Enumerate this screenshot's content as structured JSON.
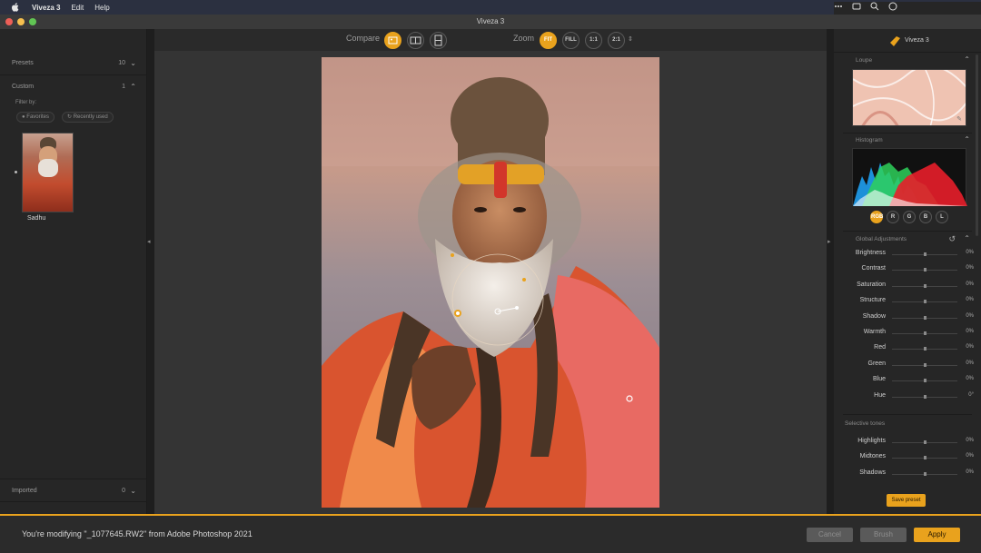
{
  "menubar": {
    "app": "Viveza 3",
    "items": [
      "Edit",
      "Help"
    ]
  },
  "window": {
    "title": "Viveza 3"
  },
  "left_panel": {
    "presets": {
      "label": "Presets",
      "count": "10"
    },
    "custom": {
      "label": "Custom",
      "count": "1"
    },
    "filter_label": "Filter by:",
    "filters": [
      "Favorites",
      "Recently used"
    ],
    "thumb_name": "Sadhu",
    "imported": {
      "label": "Imported",
      "count": "0"
    }
  },
  "toolbar": {
    "compare_label": "Compare",
    "zoom_label": "Zoom",
    "zoom_options": [
      "FIT",
      "FILL",
      "1:1",
      "2:1"
    ]
  },
  "right_panel": {
    "brand": "Viveza 3",
    "loupe_title": "Loupe",
    "histogram_title": "Histogram",
    "channels": [
      "RGB",
      "R",
      "G",
      "B",
      "L"
    ],
    "global_title": "Global Adjustments",
    "global_sliders": [
      {
        "label": "Brightness",
        "value": "0%"
      },
      {
        "label": "Contrast",
        "value": "0%"
      },
      {
        "label": "Saturation",
        "value": "0%"
      },
      {
        "label": "Structure",
        "value": "0%"
      },
      {
        "label": "Shadow",
        "value": "0%"
      },
      {
        "label": "Warmth",
        "value": "0%"
      },
      {
        "label": "Red",
        "value": "0%"
      },
      {
        "label": "Green",
        "value": "0%"
      },
      {
        "label": "Blue",
        "value": "0%"
      },
      {
        "label": "Hue",
        "value": "0°"
      }
    ],
    "selective_title": "Selective tones",
    "selective_sliders": [
      {
        "label": "Highlights",
        "value": "0%"
      },
      {
        "label": "Midtones",
        "value": "0%"
      },
      {
        "label": "Shadows",
        "value": "0%"
      }
    ],
    "save_preset": "Save preset"
  },
  "bottom": {
    "message": "You're modifying \"_1077645.RW2\" from Adobe Photoshop 2021",
    "cancel": "Cancel",
    "brush": "Brush",
    "apply": "Apply"
  },
  "colors": {
    "accent": "#e9a21d",
    "panel": "#262626",
    "canvas": "#343434"
  }
}
